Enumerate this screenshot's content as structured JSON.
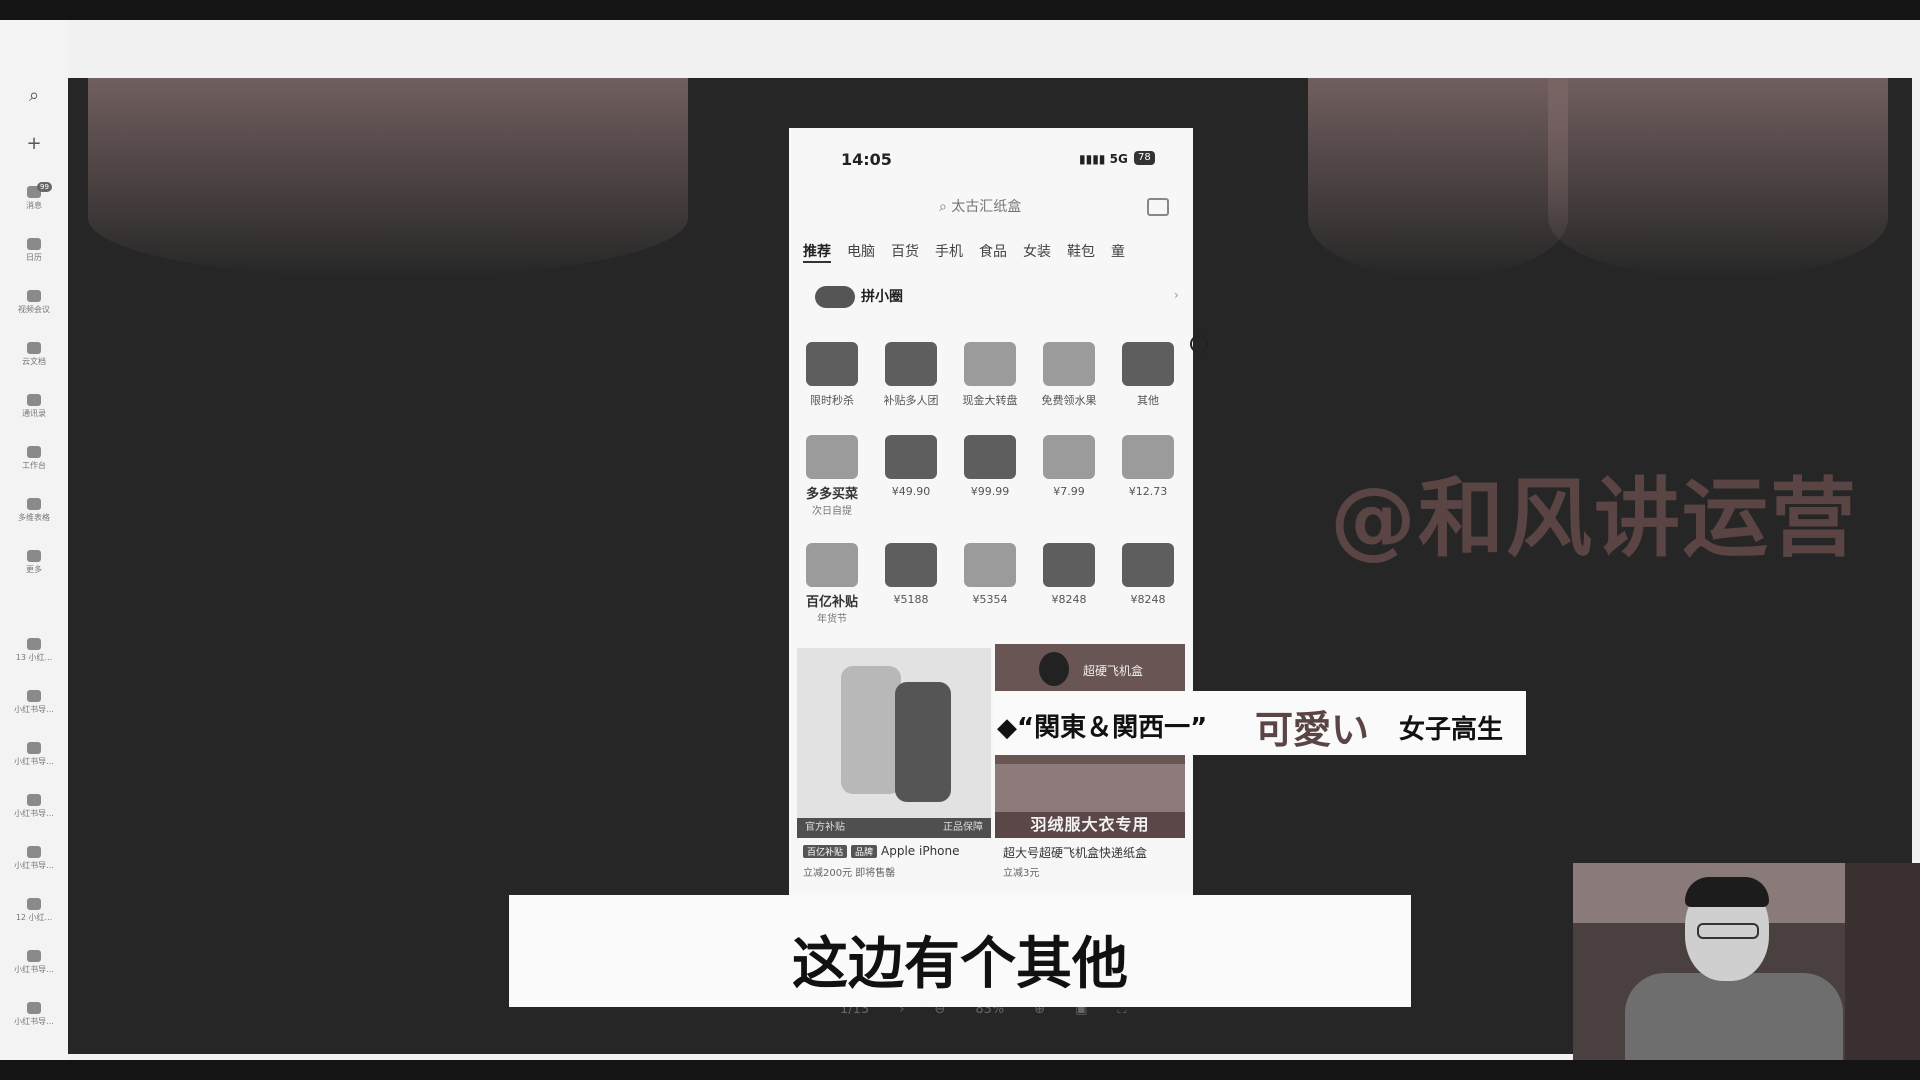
{
  "sidebar": {
    "items": [
      {
        "icon": "search-icon",
        "label": ""
      },
      {
        "icon": "plus-icon",
        "label": ""
      },
      {
        "icon": "chat-icon",
        "label": "消息",
        "badge": "99"
      },
      {
        "icon": "doc-icon",
        "label": "日历"
      },
      {
        "icon": "video-icon",
        "label": "视频会议"
      },
      {
        "icon": "file-icon",
        "label": "云文档"
      },
      {
        "icon": "contacts-icon",
        "label": "通讯录"
      },
      {
        "icon": "apps-icon",
        "label": "工作台"
      },
      {
        "icon": "grid-icon",
        "label": "多维表格"
      },
      {
        "icon": "more-icon",
        "label": "更多"
      },
      {
        "icon": "file-icon",
        "label": "13 小红..."
      },
      {
        "icon": "file-icon",
        "label": "小红书导..."
      },
      {
        "icon": "file-icon",
        "label": "小红书导..."
      },
      {
        "icon": "file-icon",
        "label": "小红书导..."
      },
      {
        "icon": "file-icon",
        "label": "小红书导..."
      },
      {
        "icon": "file-icon",
        "label": "12 小红..."
      },
      {
        "icon": "file-icon",
        "label": "小红书导..."
      },
      {
        "icon": "file-icon",
        "label": "小红书导..."
      }
    ]
  },
  "phone": {
    "time": "14:05",
    "network": "5G",
    "battery": "78",
    "search_placeholder": "太古汇纸盒",
    "tabs": [
      "推荐",
      "电脑",
      "百货",
      "手机",
      "食品",
      "女装",
      "鞋包",
      "童"
    ],
    "brand_label": "拼小圈",
    "row1": [
      {
        "label": "限时秒杀"
      },
      {
        "label": "补贴多人团"
      },
      {
        "label": "现金大转盘"
      },
      {
        "label": "免费领水果"
      },
      {
        "label": "其他"
      }
    ],
    "row2_promo": {
      "title": "多多买菜",
      "sub": "次日自提"
    },
    "row2_prices": [
      "¥49.90",
      "¥99.99",
      "¥7.99",
      "¥12.73"
    ],
    "row3_promo": {
      "title": "百亿补贴",
      "sub": "年货节"
    },
    "row3_prices": [
      "¥5188",
      "¥5354",
      "¥8248",
      "¥8248"
    ],
    "card_left_bar": "官方补贴",
    "card_left_bar_right": "正品保障",
    "card_left_pill1": "百亿补贴",
    "card_left_pill2": "品牌",
    "card_left_title": "Apple iPhone",
    "card_left_sub": "立减200元  即将售罄",
    "card_right_title": "超硬飞机盒",
    "card_right_bar": "羽绒服大衣专用",
    "card_right_caption": "超大号超硬飞机盒快递纸盒",
    "card_right_sub": "立减3元"
  },
  "watermark": "@和风讲运营",
  "overlay_tag": {
    "part1": "◆“関東＆関西一”",
    "part2": "可愛い",
    "part3": "女子高生"
  },
  "pager": {
    "page": "1/13",
    "next": "›",
    "zoom": "83%"
  },
  "subtitle": "这边有个其他"
}
